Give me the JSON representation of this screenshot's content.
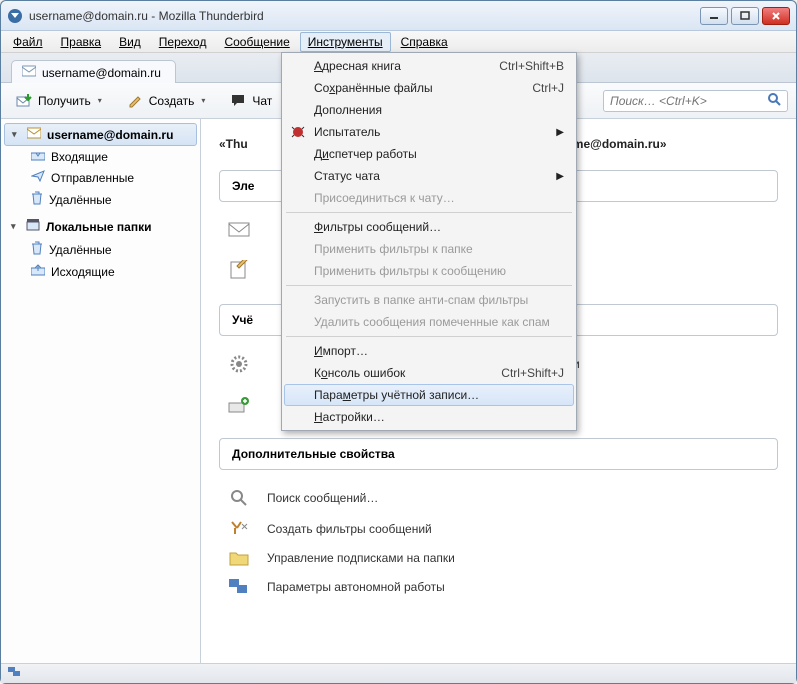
{
  "window": {
    "title": "username@domain.ru - Mozilla Thunderbird"
  },
  "menubar": {
    "file": "Файл",
    "edit": "Правка",
    "view": "Вид",
    "go": "Переход",
    "message": "Сообщение",
    "tools": "Инструменты",
    "help": "Справка"
  },
  "tab": {
    "label": "username@domain.ru"
  },
  "toolbar": {
    "get": "Получить",
    "write": "Создать",
    "chat": "Чат",
    "search_placeholder": "Поиск… <Ctrl+K>"
  },
  "sidebar": {
    "account": "username@domain.ru",
    "inbox": "Входящие",
    "sent": "Отправленные",
    "trash1": "Удалённые",
    "local": "Локальные папки",
    "trash2": "Удалённые",
    "outbox": "Исходящие"
  },
  "content": {
    "headline_left": "«Thu",
    "headline_right": "name@domain.ru»",
    "sec1": "Эле",
    "sec2": "Учё",
    "sec2_tail": "и",
    "sec3": "Дополнительные свойства",
    "act_search": "Поиск сообщений…",
    "act_filters": "Создать фильтры сообщений",
    "act_subs": "Управление подписками на папки",
    "act_offline": "Параметры автономной работы"
  },
  "dropdown": {
    "addressbook": {
      "label": "Адресная книга",
      "shortcut": "Ctrl+Shift+B"
    },
    "savedfiles": {
      "label": "Сохранённые файлы",
      "shortcut": "Ctrl+J"
    },
    "addons": "Дополнения",
    "tester": "Испытатель",
    "activity": "Диспетчер работы",
    "chatstatus": "Статус чата",
    "joinchat": "Присоединиться к чату…",
    "msgfilters": "Фильтры сообщений…",
    "applyfolder": "Применить фильтры к папке",
    "applymsg": "Применить фильтры к сообщению",
    "runjunk": "Запустить в папке анти-спам фильтры",
    "deljunk": "Удалить сообщения помеченные как спам",
    "import": "Импорт…",
    "errcons": {
      "label": "Консоль ошибок",
      "shortcut": "Ctrl+Shift+J"
    },
    "accountsettings": "Параметры учётной записи…",
    "options": "Настройки…"
  }
}
